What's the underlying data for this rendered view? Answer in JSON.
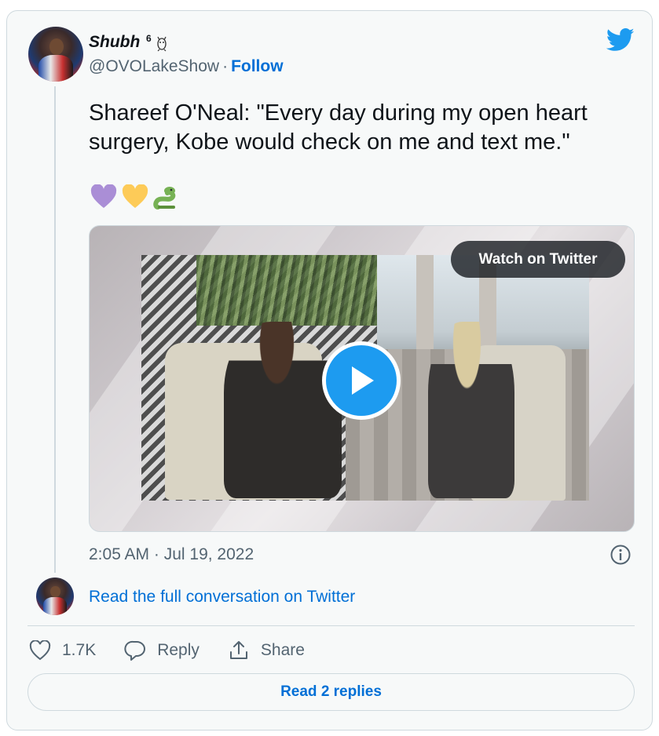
{
  "tweet": {
    "author": {
      "display_name": "Shubh",
      "display_name_suffix": "6",
      "suffix_icon": "owl-icon",
      "handle": "@OVOLakeShow",
      "separator": "·",
      "follow_label": "Follow"
    },
    "brand_icon": "twitter-bird-icon",
    "text": "Shareef O'Neal: \"Every day during my open heart surgery, Kobe would check on me and text me.\"",
    "emojis": [
      "purple-heart-icon",
      "yellow-heart-icon",
      "snake-icon"
    ],
    "media": {
      "type": "video",
      "watch_label": "Watch on Twitter",
      "play_icon": "play-icon"
    },
    "timestamp": "2:05 AM · Jul 19, 2022",
    "info_icon": "info-icon",
    "read_full_label": "Read the full conversation on Twitter",
    "actions": {
      "like_count": "1.7K",
      "reply_label": "Reply",
      "share_label": "Share"
    },
    "read_replies_label": "Read 2 replies"
  },
  "colors": {
    "link": "#006fd6",
    "twitter_blue": "#1d9bf0",
    "secondary_text": "#536471",
    "border": "#cfd9de",
    "background": "#f7f9f9"
  }
}
